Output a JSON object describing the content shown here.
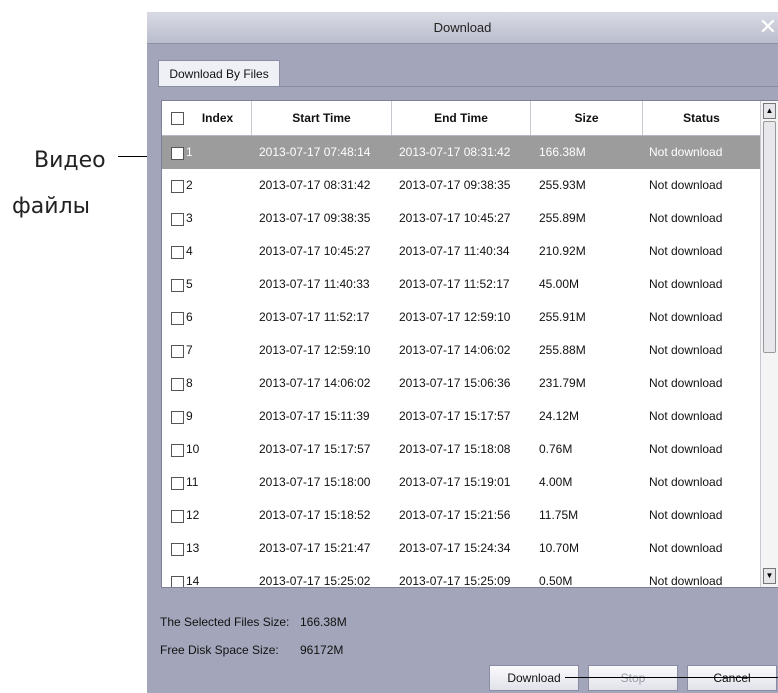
{
  "annotation": {
    "line1": "Видео",
    "line2": "файлы"
  },
  "dialog": {
    "title": "Download",
    "close": "✕"
  },
  "tabs": [
    {
      "label": "Download By Files"
    }
  ],
  "table": {
    "columns": [
      "Index",
      "Start Time",
      "End Time",
      "Size",
      "Status"
    ],
    "rows": [
      {
        "index": "1",
        "start": "2013-07-17 07:48:14",
        "end": "2013-07-17 08:31:42",
        "size": "166.38M",
        "status": "Not download"
      },
      {
        "index": "2",
        "start": "2013-07-17 08:31:42",
        "end": "2013-07-17 09:38:35",
        "size": "255.93M",
        "status": "Not download"
      },
      {
        "index": "3",
        "start": "2013-07-17 09:38:35",
        "end": "2013-07-17 10:45:27",
        "size": "255.89M",
        "status": "Not download"
      },
      {
        "index": "4",
        "start": "2013-07-17 10:45:27",
        "end": "2013-07-17 11:40:34",
        "size": "210.92M",
        "status": "Not download"
      },
      {
        "index": "5",
        "start": "2013-07-17 11:40:33",
        "end": "2013-07-17 11:52:17",
        "size": "45.00M",
        "status": "Not download"
      },
      {
        "index": "6",
        "start": "2013-07-17 11:52:17",
        "end": "2013-07-17 12:59:10",
        "size": "255.91M",
        "status": "Not download"
      },
      {
        "index": "7",
        "start": "2013-07-17 12:59:10",
        "end": "2013-07-17 14:06:02",
        "size": "255.88M",
        "status": "Not download"
      },
      {
        "index": "8",
        "start": "2013-07-17 14:06:02",
        "end": "2013-07-17 15:06:36",
        "size": "231.79M",
        "status": "Not download"
      },
      {
        "index": "9",
        "start": "2013-07-17 15:11:39",
        "end": "2013-07-17 15:17:57",
        "size": "24.12M",
        "status": "Not download"
      },
      {
        "index": "10",
        "start": "2013-07-17 15:17:57",
        "end": "2013-07-17 15:18:08",
        "size": "0.76M",
        "status": "Not download"
      },
      {
        "index": "11",
        "start": "2013-07-17 15:18:00",
        "end": "2013-07-17 15:19:01",
        "size": "4.00M",
        "status": "Not download"
      },
      {
        "index": "12",
        "start": "2013-07-17 15:18:52",
        "end": "2013-07-17 15:21:56",
        "size": "11.75M",
        "status": "Not download"
      },
      {
        "index": "13",
        "start": "2013-07-17 15:21:47",
        "end": "2013-07-17 15:24:34",
        "size": "10.70M",
        "status": "Not download"
      },
      {
        "index": "14",
        "start": "2013-07-17 15:25:02",
        "end": "2013-07-17 15:25:09",
        "size": "0.50M",
        "status": "Not download"
      }
    ],
    "selected_row": "1"
  },
  "info": {
    "selected_label": "The Selected Files Size:",
    "selected_value": "166.38M",
    "free_label": "Free Disk Space Size:",
    "free_value": "96172M"
  },
  "buttons": {
    "download": "Download",
    "stop": "Stop",
    "cancel": "Cancel"
  }
}
